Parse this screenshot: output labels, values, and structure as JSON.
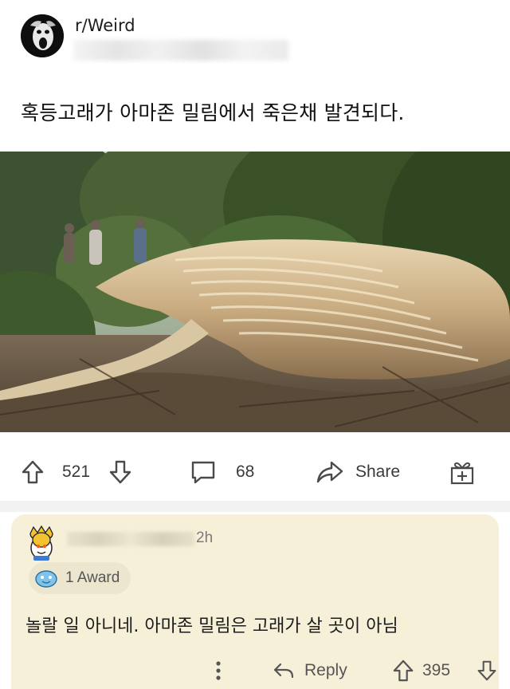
{
  "post": {
    "subreddit": "r/Weird",
    "title": "혹등고래가 아마존 밀림에서 죽은채 발견되다.",
    "upvotes": "521",
    "comments": "68",
    "share_label": "Share"
  },
  "comment": {
    "time": "2h",
    "award": "1 Award",
    "body": "놀랄 일 아니네. 아마존 밀림은 고래가 살 곳이 아님",
    "reply_label": "Reply",
    "score": "395"
  },
  "colors": {
    "comment_bg": "#f6f0d8",
    "icon_color": "#4a4a4a"
  },
  "icons": [
    "upvote-icon",
    "downvote-icon",
    "comment-icon",
    "share-icon",
    "gift-icon",
    "more-icon",
    "reply-icon"
  ]
}
